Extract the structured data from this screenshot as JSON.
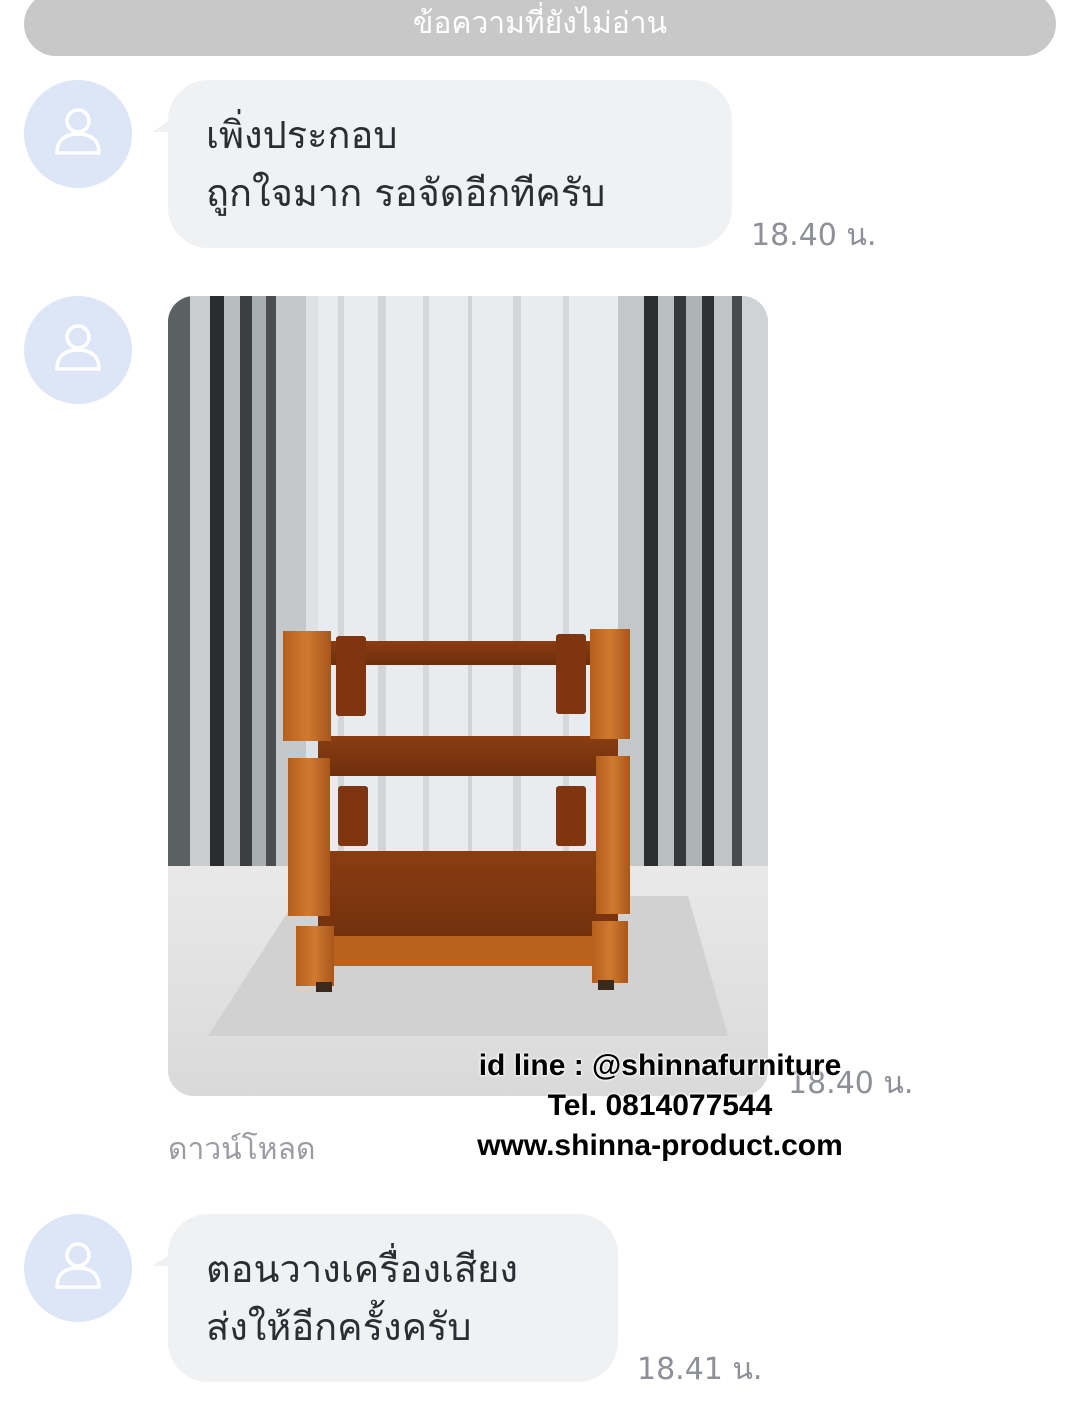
{
  "header": {
    "unread_label": "ข้อความที่ยังไม่อ่าน"
  },
  "messages": [
    {
      "lines": [
        "เพิ่งประกอบ",
        "ถูกใจมาก รอจัดอีกทีครับ"
      ],
      "time": "18.40 น."
    },
    {
      "type": "image",
      "image_subject": "wooden audio rack with three shelves in front of striped curtains",
      "time": "18.40 น.",
      "download_label": "ดาวน์โหลด"
    },
    {
      "lines": [
        "ตอนวางเครื่องเสียง",
        "ส่งให้อีกครั้งครับ"
      ],
      "time": "18.41 น."
    }
  ],
  "watermark": {
    "line1": "id line : @shinnafurniture",
    "line2": "Tel. 0814077544",
    "line3": "www.shinna-product.com"
  },
  "colors": {
    "bubble": "#f0f1f3",
    "avatar_bg": "#dde6f6",
    "unread_bar": "#c8c8c8",
    "timestamp": "#8d9097"
  }
}
